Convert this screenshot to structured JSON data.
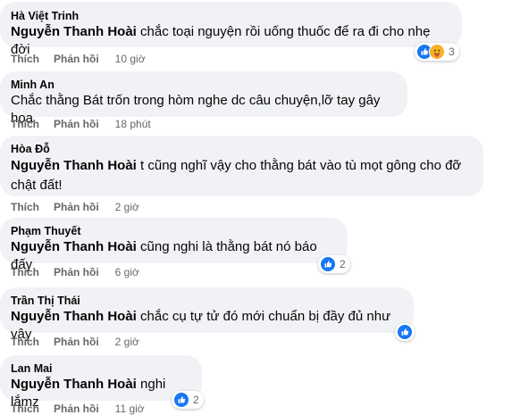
{
  "labels": {
    "like": "Thích",
    "reply": "Phản hồi"
  },
  "comments": [
    {
      "author": "Hà Việt Trinh",
      "mention": "Nguyễn Thanh Hoài",
      "text": " chắc toại nguyện rồi uống thuốc để ra đi cho nhẹ đời",
      "time": "10 giờ",
      "reactions": [
        "like-icon",
        "care-icon"
      ],
      "reaction_count": "3"
    },
    {
      "author": "Minh An",
      "mention": "",
      "text": "Chắc thằng Bát trốn trong hòm nghe dc câu chuyện,lỡ tay gây họa",
      "time": "18 phút",
      "reactions": [],
      "reaction_count": ""
    },
    {
      "author": "Hòa Đỗ",
      "mention": "Nguyễn Thanh Hoài",
      "text": " t cũng nghĩ vậy cho thằng bát vào tù mọt gông cho đỡ chật đất!",
      "time": "2 giờ",
      "reactions": [],
      "reaction_count": ""
    },
    {
      "author": "Phạm Thuyết",
      "mention": "Nguyễn Thanh Hoài",
      "text": " cũng nghi là thằng bát nó báo đấy",
      "time": "6 giờ",
      "reactions": [
        "like-icon"
      ],
      "reaction_count": "2"
    },
    {
      "author": "Trần Thị Thái",
      "mention": "Nguyễn Thanh Hoài",
      "text": " chắc cụ tự tử đó mới chuẩn bị đầy đủ như vậy",
      "time": "2 giờ",
      "reactions": [
        "like-icon"
      ],
      "reaction_count": ""
    },
    {
      "author": "Lan Mai",
      "mention": "Nguyễn Thanh Hoài",
      "text": " nghi lắmz",
      "time": "11 giờ",
      "reactions": [
        "like-icon"
      ],
      "reaction_count": "2"
    }
  ],
  "colors": {
    "bubble": "#f0f2f5",
    "like": "#1877f2",
    "care": "#f7b125",
    "meta": "#65676b"
  }
}
